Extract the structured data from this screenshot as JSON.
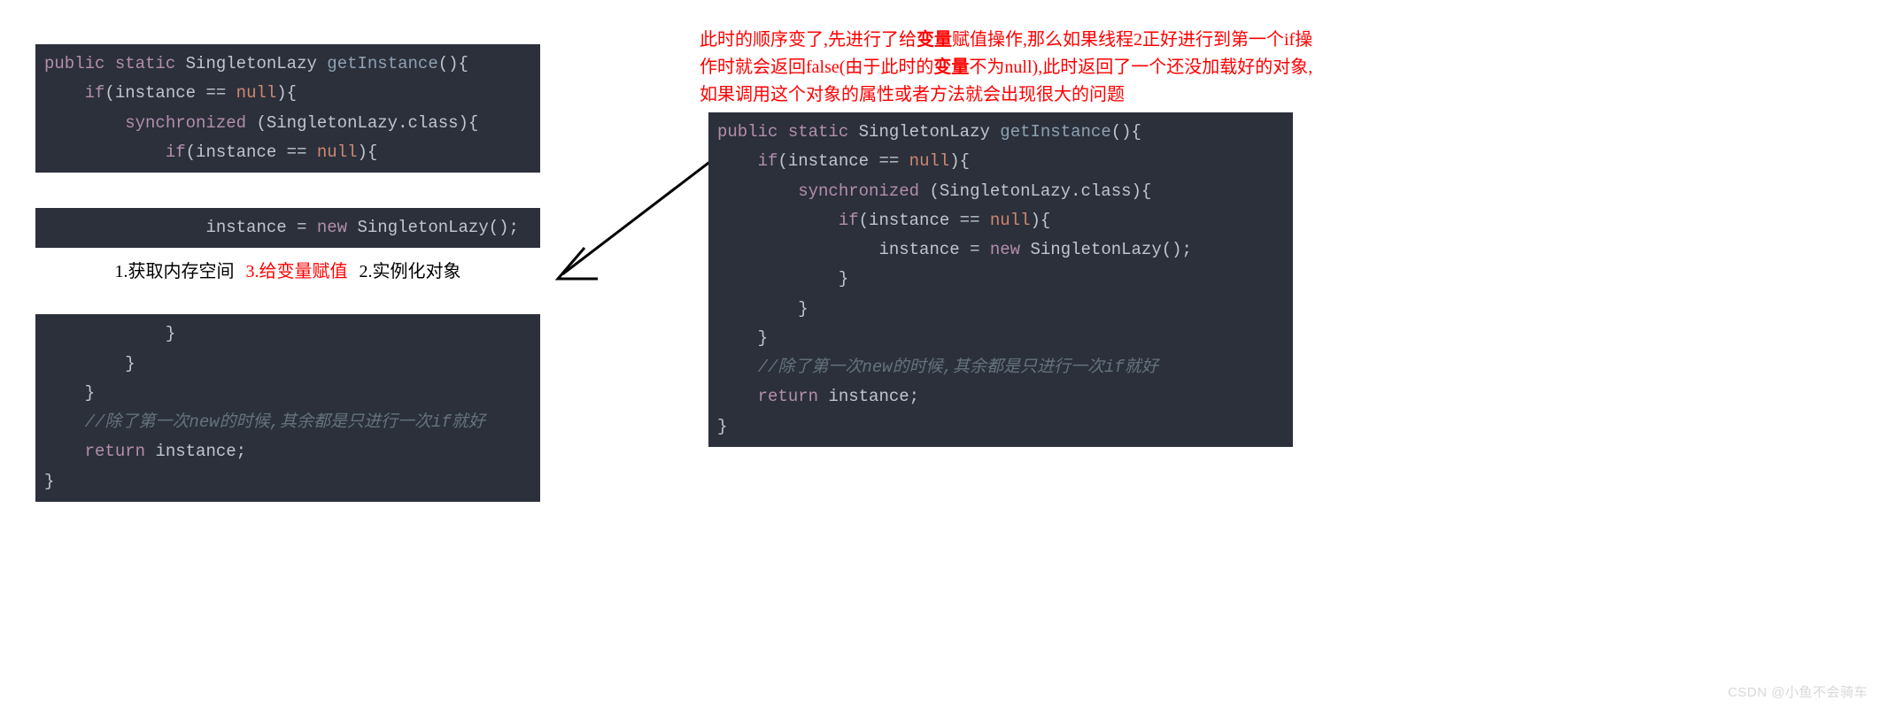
{
  "code_left_block1": [
    {
      "indent": 0,
      "tokens": [
        {
          "c": "kw-public",
          "t": "public"
        },
        {
          "c": "sp",
          "t": " "
        },
        {
          "c": "kw-static",
          "t": "static"
        },
        {
          "c": "sp",
          "t": " "
        },
        {
          "c": "type-name",
          "t": "SingletonLazy"
        },
        {
          "c": "sp",
          "t": " "
        },
        {
          "c": "fn-name",
          "t": "getInstance"
        },
        {
          "c": "punct",
          "t": "(){"
        }
      ]
    },
    {
      "indent": 1,
      "tokens": [
        {
          "c": "kw-if",
          "t": "if"
        },
        {
          "c": "punct",
          "t": "("
        },
        {
          "c": "var-name",
          "t": "instance"
        },
        {
          "c": "sp",
          "t": " "
        },
        {
          "c": "punct",
          "t": "=="
        },
        {
          "c": "sp",
          "t": " "
        },
        {
          "c": "kw-null",
          "t": "null"
        },
        {
          "c": "punct",
          "t": "){"
        }
      ]
    },
    {
      "indent": 2,
      "tokens": [
        {
          "c": "kw-sync",
          "t": "synchronized"
        },
        {
          "c": "sp",
          "t": " "
        },
        {
          "c": "punct",
          "t": "("
        },
        {
          "c": "cls-name",
          "t": "SingletonLazy"
        },
        {
          "c": "punct",
          "t": "."
        },
        {
          "c": "cls-name",
          "t": "class"
        },
        {
          "c": "punct",
          "t": "){"
        }
      ]
    },
    {
      "indent": 3,
      "tokens": [
        {
          "c": "kw-if",
          "t": "if"
        },
        {
          "c": "punct",
          "t": "("
        },
        {
          "c": "var-name",
          "t": "instance"
        },
        {
          "c": "sp",
          "t": " "
        },
        {
          "c": "punct",
          "t": "=="
        },
        {
          "c": "sp",
          "t": " "
        },
        {
          "c": "kw-null",
          "t": "null"
        },
        {
          "c": "punct",
          "t": "){"
        }
      ]
    }
  ],
  "code_left_block2": [
    {
      "indent": 4,
      "tokens": [
        {
          "c": "var-name",
          "t": "instance"
        },
        {
          "c": "sp",
          "t": " "
        },
        {
          "c": "punct",
          "t": "="
        },
        {
          "c": "sp",
          "t": " "
        },
        {
          "c": "kw-new",
          "t": "new"
        },
        {
          "c": "sp",
          "t": " "
        },
        {
          "c": "type-name",
          "t": "SingletonLazy"
        },
        {
          "c": "punct",
          "t": "();"
        }
      ]
    }
  ],
  "steps": {
    "s1": "1.获取内存空间",
    "s3": "3.给变量赋值",
    "s2": "2.实例化对象"
  },
  "code_left_block3": [
    {
      "indent": 3,
      "tokens": [
        {
          "c": "punct",
          "t": "}"
        }
      ]
    },
    {
      "indent": 2,
      "tokens": [
        {
          "c": "punct",
          "t": "}"
        }
      ]
    },
    {
      "indent": 1,
      "tokens": [
        {
          "c": "punct",
          "t": "}"
        }
      ]
    },
    {
      "indent": 1,
      "tokens": [
        {
          "c": "comment",
          "t": "//除了第一次new的时候,其余都是只进行一次if就好"
        }
      ]
    },
    {
      "indent": 1,
      "tokens": [
        {
          "c": "kw-return",
          "t": "return"
        },
        {
          "c": "sp",
          "t": " "
        },
        {
          "c": "var-name",
          "t": "instance"
        },
        {
          "c": "punct",
          "t": ";"
        }
      ]
    },
    {
      "indent": 0,
      "tokens": [
        {
          "c": "punct",
          "t": "}"
        }
      ]
    }
  ],
  "right_note_segments": [
    {
      "t": "此时的顺序变了,先进行了给",
      "b": false
    },
    {
      "t": "变量",
      "b": true
    },
    {
      "t": "赋值操作,那么如果线程2正好进行到第一个if操作时就会返回false(由于此时的",
      "b": false
    },
    {
      "t": "变量",
      "b": true
    },
    {
      "t": "不为null),此时返回了一个还没加载好的对象,如果调用这个对象的属性或者方法就会出现很大的问题",
      "b": false
    }
  ],
  "code_right": [
    {
      "indent": 0,
      "tokens": [
        {
          "c": "kw-public",
          "t": "public"
        },
        {
          "c": "sp",
          "t": " "
        },
        {
          "c": "kw-static",
          "t": "static"
        },
        {
          "c": "sp",
          "t": " "
        },
        {
          "c": "type-name",
          "t": "SingletonLazy"
        },
        {
          "c": "sp",
          "t": " "
        },
        {
          "c": "fn-name",
          "t": "getInstance"
        },
        {
          "c": "punct",
          "t": "(){"
        }
      ]
    },
    {
      "indent": 1,
      "tokens": [
        {
          "c": "kw-if",
          "t": "if"
        },
        {
          "c": "punct",
          "t": "("
        },
        {
          "c": "var-name",
          "t": "instance"
        },
        {
          "c": "sp",
          "t": " "
        },
        {
          "c": "punct",
          "t": "=="
        },
        {
          "c": "sp",
          "t": " "
        },
        {
          "c": "kw-null",
          "t": "null"
        },
        {
          "c": "punct",
          "t": "){"
        }
      ]
    },
    {
      "indent": 2,
      "tokens": [
        {
          "c": "kw-sync",
          "t": "synchronized"
        },
        {
          "c": "sp",
          "t": " "
        },
        {
          "c": "punct",
          "t": "("
        },
        {
          "c": "cls-name",
          "t": "SingletonLazy"
        },
        {
          "c": "punct",
          "t": "."
        },
        {
          "c": "cls-name",
          "t": "class"
        },
        {
          "c": "punct",
          "t": "){"
        }
      ]
    },
    {
      "indent": 3,
      "tokens": [
        {
          "c": "kw-if",
          "t": "if"
        },
        {
          "c": "punct",
          "t": "("
        },
        {
          "c": "var-name",
          "t": "instance"
        },
        {
          "c": "sp",
          "t": " "
        },
        {
          "c": "punct",
          "t": "=="
        },
        {
          "c": "sp",
          "t": " "
        },
        {
          "c": "kw-null",
          "t": "null"
        },
        {
          "c": "punct",
          "t": "){"
        }
      ]
    },
    {
      "indent": 4,
      "tokens": [
        {
          "c": "var-name",
          "t": "instance"
        },
        {
          "c": "sp",
          "t": " "
        },
        {
          "c": "punct",
          "t": "="
        },
        {
          "c": "sp",
          "t": " "
        },
        {
          "c": "kw-new",
          "t": "new"
        },
        {
          "c": "sp",
          "t": " "
        },
        {
          "c": "type-name",
          "t": "SingletonLazy"
        },
        {
          "c": "punct",
          "t": "();"
        }
      ]
    },
    {
      "indent": 3,
      "tokens": [
        {
          "c": "punct",
          "t": "}"
        }
      ]
    },
    {
      "indent": 2,
      "tokens": [
        {
          "c": "punct",
          "t": "}"
        }
      ]
    },
    {
      "indent": 1,
      "tokens": [
        {
          "c": "punct",
          "t": "}"
        }
      ]
    },
    {
      "indent": 1,
      "tokens": [
        {
          "c": "comment",
          "t": "//除了第一次new的时候,其余都是只进行一次if就好"
        }
      ]
    },
    {
      "indent": 1,
      "tokens": [
        {
          "c": "kw-return",
          "t": "return"
        },
        {
          "c": "sp",
          "t": " "
        },
        {
          "c": "var-name",
          "t": "instance"
        },
        {
          "c": "punct",
          "t": ";"
        }
      ]
    },
    {
      "indent": 0,
      "tokens": [
        {
          "c": "punct",
          "t": "}"
        }
      ]
    }
  ],
  "watermark": "CSDN @小鱼不会骑车"
}
